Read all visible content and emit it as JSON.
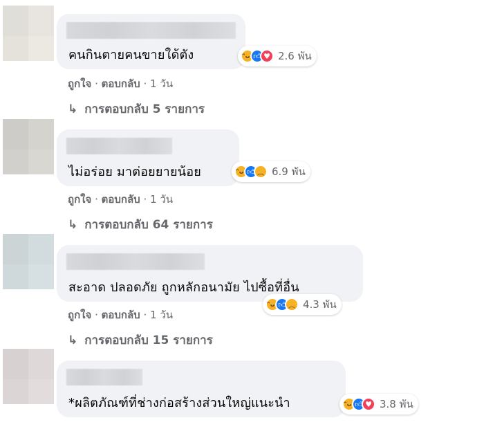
{
  "comments": [
    {
      "text": "คนกินตายคนขายใด้ตัง",
      "reaction_count": "2.6 พัน",
      "reactions": [
        "haha-icon",
        "like-icon",
        "love-icon"
      ],
      "like_label": "ถูกใจ",
      "reply_label": "ตอบกลับ",
      "time": "1 วัน",
      "replies_label": "การตอบกลับ 5 รายการ"
    },
    {
      "text": "ไม่อร่อย มาต่อยยายน้อย",
      "reaction_count": "6.9 พัน",
      "reactions": [
        "haha-icon",
        "like-icon",
        "sad-icon"
      ],
      "like_label": "ถูกใจ",
      "reply_label": "ตอบกลับ",
      "time": "1 วัน",
      "replies_label": "การตอบกลับ 64 รายการ"
    },
    {
      "text": "สะอาด ปลอดภัย ถูกหลักอนามัย ไปซื้อที่อื่น",
      "reaction_count": "4.3 พัน",
      "reactions": [
        "haha-icon",
        "like-icon",
        "sad-icon"
      ],
      "like_label": "ถูกใจ",
      "reply_label": "ตอบกลับ",
      "time": "1 วัน",
      "replies_label": "การตอบกลับ 15 รายการ"
    },
    {
      "text": "*ผลิตภัณฑ์ที่ช่างก่อสร้างส่วนใหญ่แนะนำ",
      "reaction_count": "3.8 พัน",
      "reactions": [
        "haha-icon",
        "like-icon",
        "love-icon"
      ]
    }
  ],
  "separator": "·",
  "colors": {
    "like": "#1877f2",
    "love": "#f33e58",
    "haha": "#f7b125",
    "bubble": "#f0f2f5",
    "meta": "#65676b"
  }
}
